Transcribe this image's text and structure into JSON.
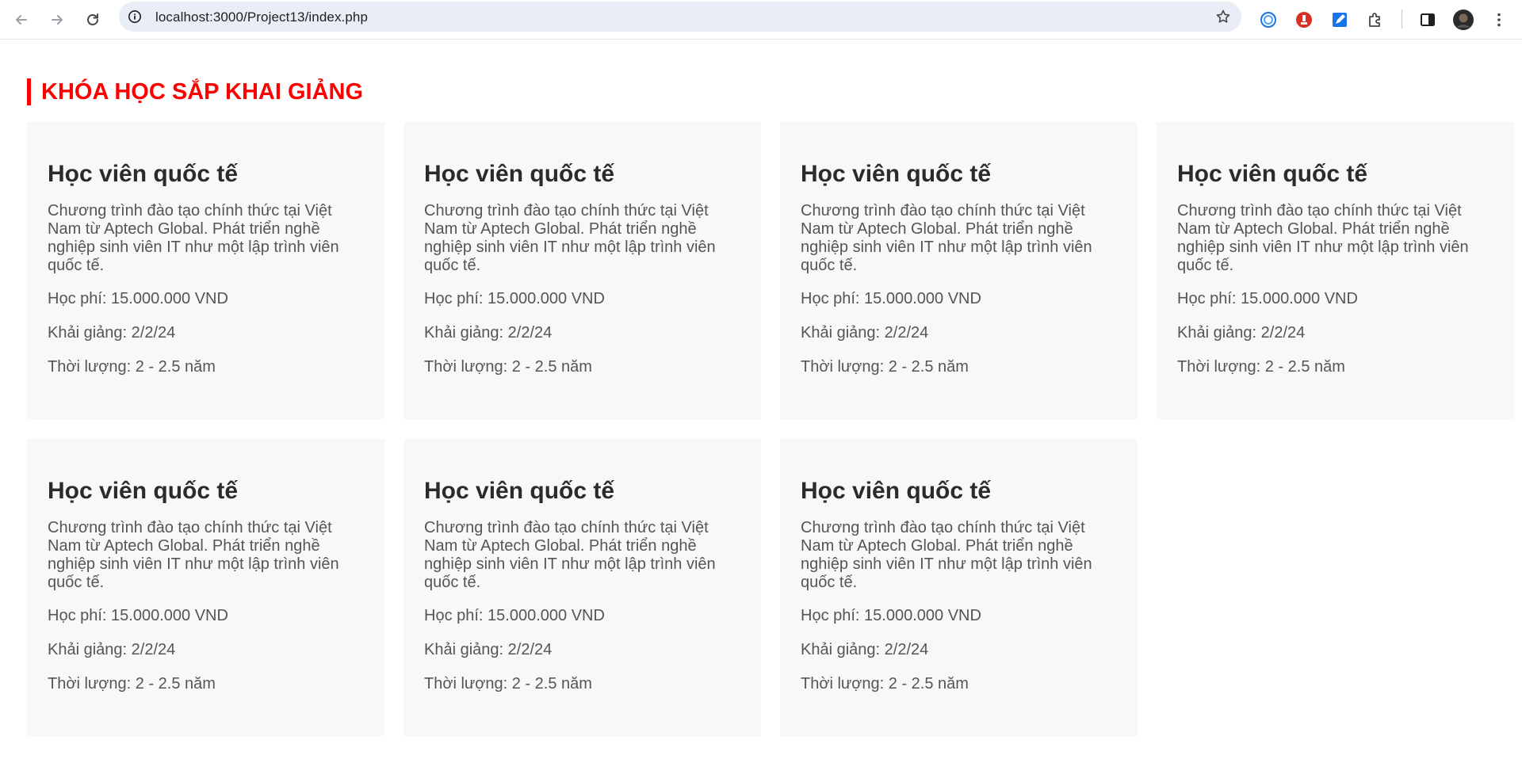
{
  "browser": {
    "url": "localhost:3000/Project13/index.php",
    "icons": {
      "back": "arrow-left-icon",
      "forward": "arrow-right-icon",
      "reload": "reload-icon",
      "site_info": "site-info-icon",
      "bookmark": "star-icon",
      "extensions": [
        "extension-1-icon",
        "extension-2-icon",
        "extension-3-icon",
        "puzzle-icon"
      ],
      "side_panel": "side-panel-icon",
      "profile": "avatar",
      "menu": "kebab-menu-icon"
    }
  },
  "page": {
    "section_title": "KHÓA HỌC SẮP KHAI GIẢNG",
    "accent_color": "#ff0000",
    "courses": [
      {
        "title": "Học viên quốc tế",
        "description": "Chương trình đào tạo chính thức tại Việt Nam từ Aptech Global. Phát triển nghề nghiệp sinh viên IT như một lập trình viên quốc tế.",
        "fee": "Học phí: 15.000.000 VND",
        "start": "Khải giảng: 2/2/24",
        "duration": "Thời lượng: 2 - 2.5 năm"
      },
      {
        "title": "Học viên quốc tế",
        "description": "Chương trình đào tạo chính thức tại Việt Nam từ Aptech Global. Phát triển nghề nghiệp sinh viên IT như một lập trình viên quốc tế.",
        "fee": "Học phí: 15.000.000 VND",
        "start": "Khải giảng: 2/2/24",
        "duration": "Thời lượng: 2 - 2.5 năm"
      },
      {
        "title": "Học viên quốc tế",
        "description": "Chương trình đào tạo chính thức tại Việt Nam từ Aptech Global. Phát triển nghề nghiệp sinh viên IT như một lập trình viên quốc tế.",
        "fee": "Học phí: 15.000.000 VND",
        "start": "Khải giảng: 2/2/24",
        "duration": "Thời lượng: 2 - 2.5 năm"
      },
      {
        "title": "Học viên quốc tế",
        "description": "Chương trình đào tạo chính thức tại Việt Nam từ Aptech Global. Phát triển nghề nghiệp sinh viên IT như một lập trình viên quốc tế.",
        "fee": "Học phí: 15.000.000 VND",
        "start": "Khải giảng: 2/2/24",
        "duration": "Thời lượng: 2 - 2.5 năm"
      },
      {
        "title": "Học viên quốc tế",
        "description": "Chương trình đào tạo chính thức tại Việt Nam từ Aptech Global. Phát triển nghề nghiệp sinh viên IT như một lập trình viên quốc tế.",
        "fee": "Học phí: 15.000.000 VND",
        "start": "Khải giảng: 2/2/24",
        "duration": "Thời lượng: 2 - 2.5 năm"
      },
      {
        "title": "Học viên quốc tế",
        "description": "Chương trình đào tạo chính thức tại Việt Nam từ Aptech Global. Phát triển nghề nghiệp sinh viên IT như một lập trình viên quốc tế.",
        "fee": "Học phí: 15.000.000 VND",
        "start": "Khải giảng: 2/2/24",
        "duration": "Thời lượng: 2 - 2.5 năm"
      },
      {
        "title": "Học viên quốc tế",
        "description": "Chương trình đào tạo chính thức tại Việt Nam từ Aptech Global. Phát triển nghề nghiệp sinh viên IT như một lập trình viên quốc tế.",
        "fee": "Học phí: 15.000.000 VND",
        "start": "Khải giảng: 2/2/24",
        "duration": "Thời lượng: 2 - 2.5 năm"
      }
    ]
  }
}
